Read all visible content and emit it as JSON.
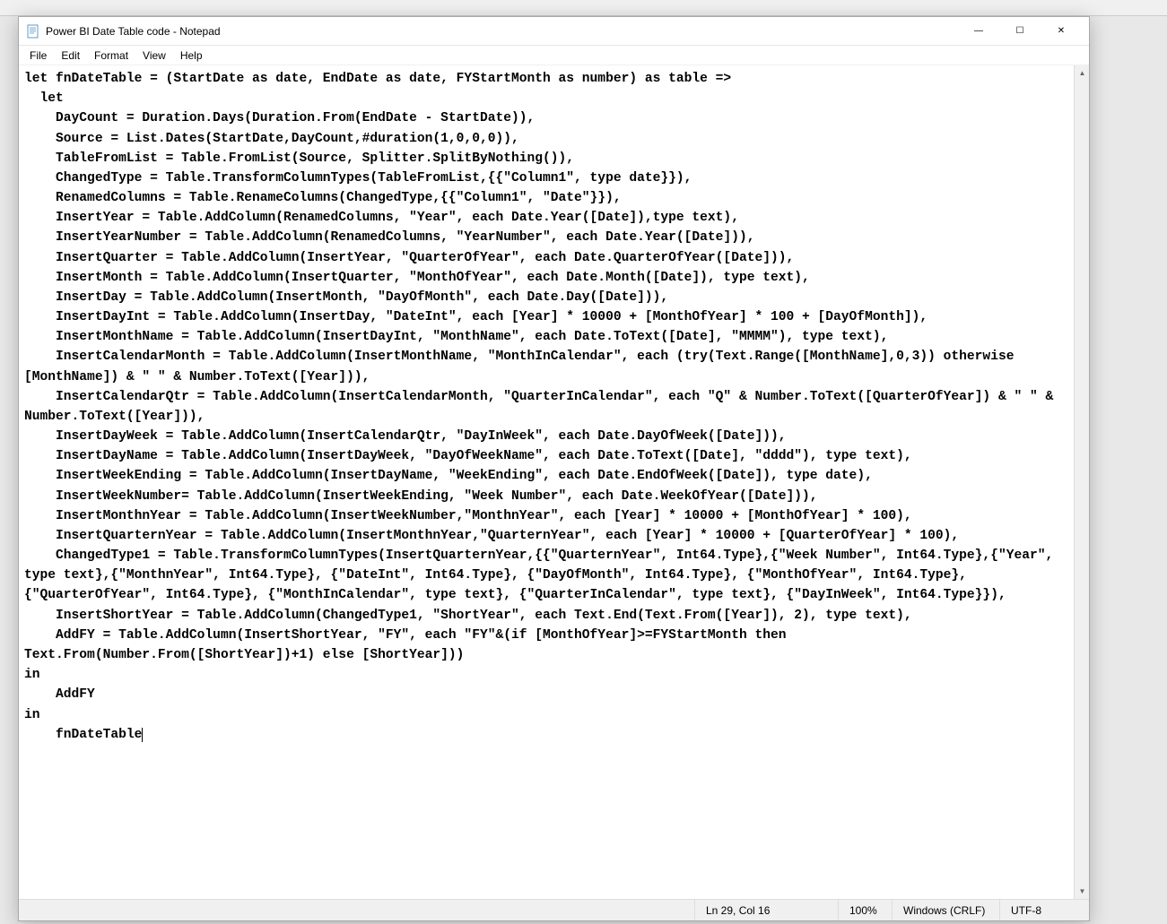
{
  "window": {
    "title": "Power BI Date Table code - Notepad",
    "controls": {
      "minimize": "—",
      "maximize": "☐",
      "close": "✕"
    }
  },
  "menu": {
    "items": [
      "File",
      "Edit",
      "Format",
      "View",
      "Help"
    ]
  },
  "editor": {
    "content": "let fnDateTable = (StartDate as date, EndDate as date, FYStartMonth as number) as table =>\n  let\n    DayCount = Duration.Days(Duration.From(EndDate - StartDate)),\n    Source = List.Dates(StartDate,DayCount,#duration(1,0,0,0)),\n    TableFromList = Table.FromList(Source, Splitter.SplitByNothing()),\n    ChangedType = Table.TransformColumnTypes(TableFromList,{{\"Column1\", type date}}),\n    RenamedColumns = Table.RenameColumns(ChangedType,{{\"Column1\", \"Date\"}}),\n    InsertYear = Table.AddColumn(RenamedColumns, \"Year\", each Date.Year([Date]),type text),\n    InsertYearNumber = Table.AddColumn(RenamedColumns, \"YearNumber\", each Date.Year([Date])),\n    InsertQuarter = Table.AddColumn(InsertYear, \"QuarterOfYear\", each Date.QuarterOfYear([Date])),\n    InsertMonth = Table.AddColumn(InsertQuarter, \"MonthOfYear\", each Date.Month([Date]), type text),\n    InsertDay = Table.AddColumn(InsertMonth, \"DayOfMonth\", each Date.Day([Date])),\n    InsertDayInt = Table.AddColumn(InsertDay, \"DateInt\", each [Year] * 10000 + [MonthOfYear] * 100 + [DayOfMonth]),\n    InsertMonthName = Table.AddColumn(InsertDayInt, \"MonthName\", each Date.ToText([Date], \"MMMM\"), type text),\n    InsertCalendarMonth = Table.AddColumn(InsertMonthName, \"MonthInCalendar\", each (try(Text.Range([MonthName],0,3)) otherwise [MonthName]) & \" \" & Number.ToText([Year])),\n    InsertCalendarQtr = Table.AddColumn(InsertCalendarMonth, \"QuarterInCalendar\", each \"Q\" & Number.ToText([QuarterOfYear]) & \" \" & Number.ToText([Year])),\n    InsertDayWeek = Table.AddColumn(InsertCalendarQtr, \"DayInWeek\", each Date.DayOfWeek([Date])),\n    InsertDayName = Table.AddColumn(InsertDayWeek, \"DayOfWeekName\", each Date.ToText([Date], \"dddd\"), type text),\n    InsertWeekEnding = Table.AddColumn(InsertDayName, \"WeekEnding\", each Date.EndOfWeek([Date]), type date),\n    InsertWeekNumber= Table.AddColumn(InsertWeekEnding, \"Week Number\", each Date.WeekOfYear([Date])),\n    InsertMonthnYear = Table.AddColumn(InsertWeekNumber,\"MonthnYear\", each [Year] * 10000 + [MonthOfYear] * 100),\n    InsertQuarternYear = Table.AddColumn(InsertMonthnYear,\"QuarternYear\", each [Year] * 10000 + [QuarterOfYear] * 100),\n    ChangedType1 = Table.TransformColumnTypes(InsertQuarternYear,{{\"QuarternYear\", Int64.Type},{\"Week Number\", Int64.Type},{\"Year\", type text},{\"MonthnYear\", Int64.Type}, {\"DateInt\", Int64.Type}, {\"DayOfMonth\", Int64.Type}, {\"MonthOfYear\", Int64.Type}, {\"QuarterOfYear\", Int64.Type}, {\"MonthInCalendar\", type text}, {\"QuarterInCalendar\", type text}, {\"DayInWeek\", Int64.Type}}),\n    InsertShortYear = Table.AddColumn(ChangedType1, \"ShortYear\", each Text.End(Text.From([Year]), 2), type text),\n    AddFY = Table.AddColumn(InsertShortYear, \"FY\", each \"FY\"&(if [MonthOfYear]>=FYStartMonth then Text.From(Number.From([ShortYear])+1) else [ShortYear]))\nin\n    AddFY\nin\n    fnDateTable"
  },
  "statusbar": {
    "position": "Ln 29, Col 16",
    "zoom": "100%",
    "line_ending": "Windows (CRLF)",
    "encoding": "UTF-8"
  },
  "scrollbar": {
    "up": "▲",
    "down": "▼"
  }
}
